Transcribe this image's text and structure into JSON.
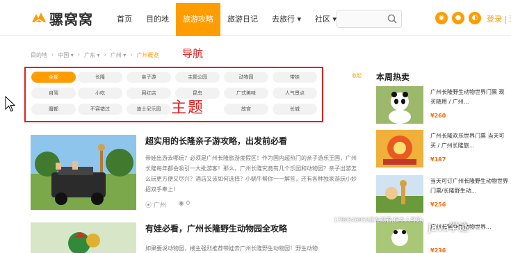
{
  "brand": {
    "name": "骡窝窝",
    "accent": "#ff9d00"
  },
  "nav": {
    "items": [
      {
        "label": "首页"
      },
      {
        "label": "目的地"
      },
      {
        "label": "旅游攻略"
      },
      {
        "label": "旅游日记"
      },
      {
        "label": "去旅行 ▾"
      },
      {
        "label": "社区 ▾"
      }
    ],
    "active_index": 2
  },
  "search": {
    "placeholder": ""
  },
  "header_right": {
    "login_label": "登录 | 注"
  },
  "breadcrumb": {
    "items": [
      "目的地",
      "›",
      "中国 ▾",
      "›",
      "广东 ▾",
      "›",
      "广州 ▾",
      "›"
    ],
    "current": "广州概览"
  },
  "annotations": {
    "nav_label": "导航",
    "topic_label": "主题"
  },
  "tags": [
    "全部",
    "长隆",
    "亲子游",
    "主题公园",
    "动物园",
    "带娃",
    "自驾",
    "小吃",
    "网红店",
    "昆虫",
    "广式美味",
    "人气景点",
    "魔都",
    "不容错过",
    "迪士尼乐园",
    "",
    "故宫",
    "长城"
  ],
  "tags_active_index": 0,
  "collect_label": "收起",
  "articles": [
    {
      "title": "超实用的长隆亲子游攻略，出发前必看",
      "body": "带娃出游去哪玩？必须是广州长隆旅游度假区！作为国内超热门的亲子游乐王国，广州长隆每年都会吸引一大批游客！那么，广州长隆究竟有几个乐园和动物园？亲子出游怎么玩更方便又尽兴？酒店又该如何选择？小蜗牛帮你一一解答，还有各种独家游玩小妙招双手奉上！",
      "location": "广州",
      "views": "0"
    },
    {
      "title": "有娃必看，广州长隆野生动物园全攻略",
      "body": "如果要说动物园，楼主强烈推荐带娃去广州长隆野生动物园！野生动物"
    }
  ],
  "sidebar": {
    "title": "本周热卖",
    "items": [
      {
        "title": "广州长隆野生动物世界门票 现买随用 / 广州...",
        "price": "¥260"
      },
      {
        "title": "广州长隆欢乐世界门票 当天可买 / 广州长隆旅...",
        "price": "¥187"
      },
      {
        "title": "当天可订广州长隆野生动物世界门票/长隆野生动...",
        "price": "¥256"
      },
      {
        "title": "广州长隆野生动物世界...",
        "price": "¥236"
      }
    ]
  },
  "overlay": {
    "viewer_text": "1780546953正在观看(仅本人可见)",
    "watermark": "Java学迹"
  }
}
